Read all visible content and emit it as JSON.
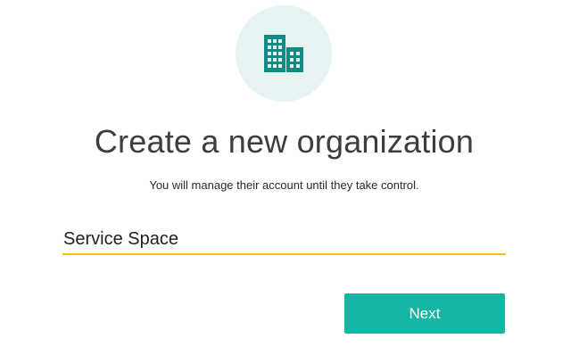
{
  "header": {
    "icon": "office-building-icon",
    "icon_color": "#0f8c84",
    "circle_color": "#e6f3f3"
  },
  "title": "Create a new organization",
  "subtitle": "You will manage their account until they take control.",
  "organization_name": {
    "value": "Service Space",
    "underline_color": "#f2c200"
  },
  "next_button": {
    "label": "Next",
    "color": "#17b5a5"
  }
}
